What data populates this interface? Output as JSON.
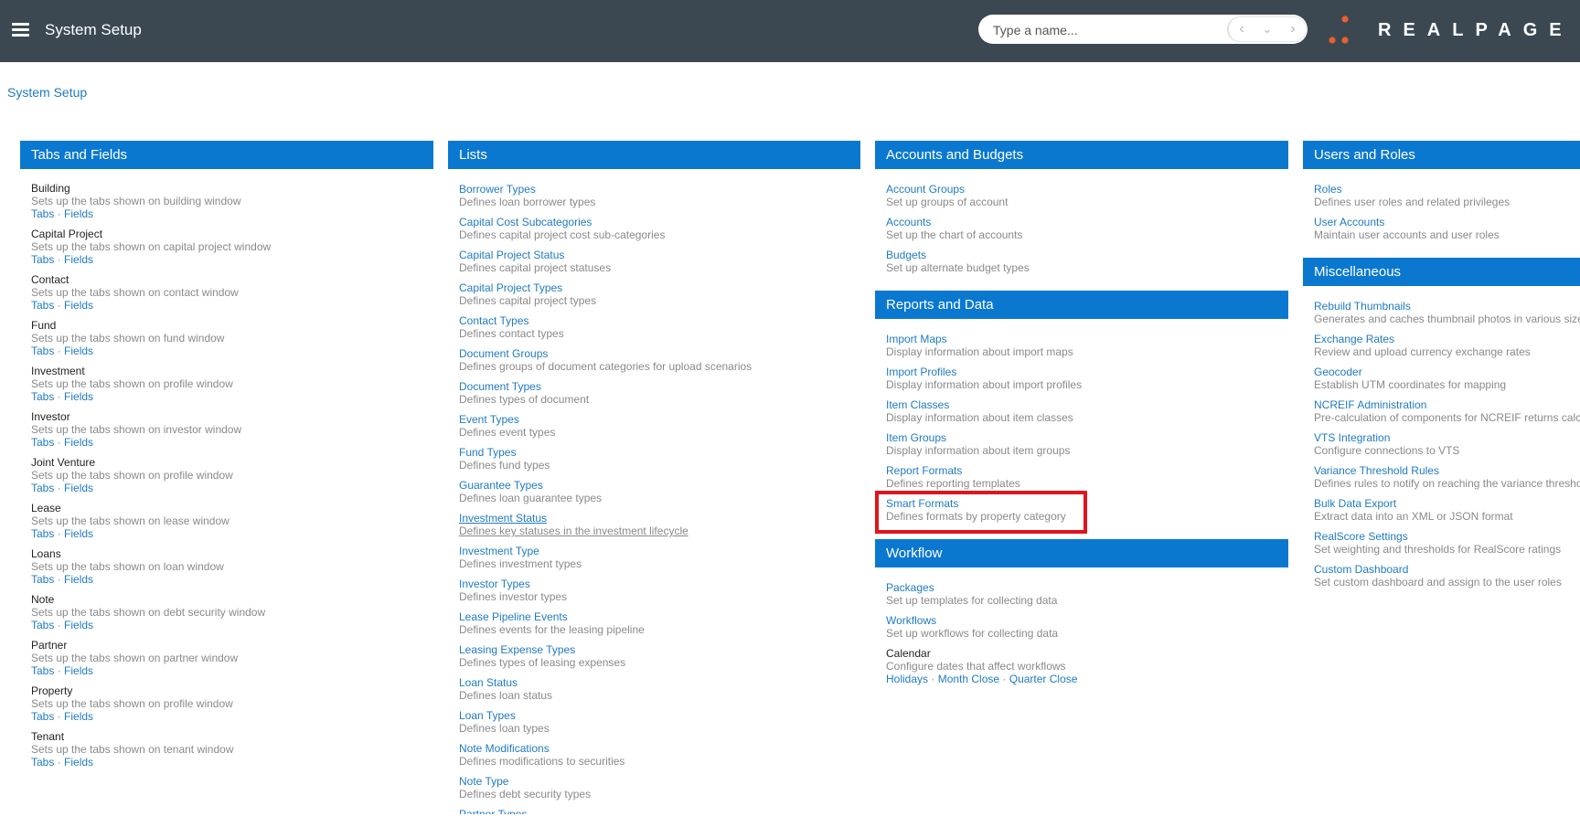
{
  "header": {
    "title": "System Setup",
    "search_placeholder": "Type a name...",
    "brand": "REALPAGE"
  },
  "breadcrumb": "System Setup",
  "tabs_and_fields": {
    "title": "Tabs and Fields",
    "tabs_label": "Tabs",
    "fields_label": "Fields",
    "items": [
      {
        "title": "Building",
        "desc": "Sets up the tabs shown on building window"
      },
      {
        "title": "Capital Project",
        "desc": "Sets up the tabs shown on capital project window"
      },
      {
        "title": "Contact",
        "desc": "Sets up the tabs shown on contact window"
      },
      {
        "title": "Fund",
        "desc": "Sets up the tabs shown on fund window"
      },
      {
        "title": "Investment",
        "desc": "Sets up the tabs shown on profile window"
      },
      {
        "title": "Investor",
        "desc": "Sets up the tabs shown on investor window"
      },
      {
        "title": "Joint Venture",
        "desc": "Sets up the tabs shown on profile window"
      },
      {
        "title": "Lease",
        "desc": "Sets up the tabs shown on lease window"
      },
      {
        "title": "Loans",
        "desc": "Sets up the tabs shown on loan window"
      },
      {
        "title": "Note",
        "desc": "Sets up the tabs shown on debt security window"
      },
      {
        "title": "Partner",
        "desc": "Sets up the tabs shown on partner window"
      },
      {
        "title": "Property",
        "desc": "Sets up the tabs shown on profile window"
      },
      {
        "title": "Tenant",
        "desc": "Sets up the tabs shown on tenant window"
      }
    ]
  },
  "lists": {
    "title": "Lists",
    "items": [
      {
        "title": "Borrower Types",
        "desc": "Defines loan borrower types"
      },
      {
        "title": "Capital Cost Subcategories",
        "desc": "Defines capital project cost sub-categories"
      },
      {
        "title": "Capital Project Status",
        "desc": "Defines capital project statuses"
      },
      {
        "title": "Capital Project Types",
        "desc": "Defines capital project types"
      },
      {
        "title": "Contact Types",
        "desc": "Defines contact types"
      },
      {
        "title": "Document Groups",
        "desc": "Defines groups of document categories for upload scenarios"
      },
      {
        "title": "Document Types",
        "desc": "Defines types of document"
      },
      {
        "title": "Event Types",
        "desc": "Defines event types"
      },
      {
        "title": "Fund Types",
        "desc": "Defines fund types"
      },
      {
        "title": "Guarantee Types",
        "desc": "Defines loan guarantee types"
      },
      {
        "title": "Investment Status",
        "desc": "Defines key statuses in the investment lifecycle"
      },
      {
        "title": "Investment Type",
        "desc": "Defines investment types"
      },
      {
        "title": "Investor Types",
        "desc": "Defines investor types"
      },
      {
        "title": "Lease Pipeline Events",
        "desc": "Defines events for the leasing pipeline"
      },
      {
        "title": "Leasing Expense Types",
        "desc": "Defines types of leasing expenses"
      },
      {
        "title": "Loan Status",
        "desc": "Defines loan status"
      },
      {
        "title": "Loan Types",
        "desc": "Defines loan types"
      },
      {
        "title": "Note Modifications",
        "desc": "Defines modifications to securities"
      },
      {
        "title": "Note Type",
        "desc": "Defines debt security types"
      },
      {
        "title": "Partner Types",
        "desc": ""
      }
    ]
  },
  "accounts_budgets": {
    "title": "Accounts and Budgets",
    "items": [
      {
        "title": "Account Groups",
        "desc": "Set up groups of account"
      },
      {
        "title": "Accounts",
        "desc": "Set up the chart of accounts"
      },
      {
        "title": "Budgets",
        "desc": "Set up alternate budget types"
      }
    ]
  },
  "reports_data": {
    "title": "Reports and Data",
    "items": [
      {
        "title": "Import Maps",
        "desc": "Display information about import maps"
      },
      {
        "title": "Import Profiles",
        "desc": "Display information about import profiles"
      },
      {
        "title": "Item Classes",
        "desc": "Display information about item classes"
      },
      {
        "title": "Item Groups",
        "desc": "Display information about item groups"
      },
      {
        "title": "Report Formats",
        "desc": "Defines reporting templates"
      },
      {
        "title": "Smart Formats",
        "desc": "Defines formats by property category"
      }
    ]
  },
  "workflow": {
    "title": "Workflow",
    "items": [
      {
        "title": "Packages",
        "desc": "Set up templates for collecting data"
      },
      {
        "title": "Workflows",
        "desc": "Set up workflows for collecting data"
      }
    ],
    "calendar": {
      "title": "Calendar",
      "desc": "Configure dates that affect workflows",
      "links": [
        "Holidays",
        "Month Close",
        "Quarter Close"
      ]
    }
  },
  "users_roles": {
    "title": "Users and Roles",
    "items": [
      {
        "title": "Roles",
        "desc": "Defines user roles and related privileges"
      },
      {
        "title": "User Accounts",
        "desc": "Maintain user accounts and user roles"
      }
    ]
  },
  "miscellaneous": {
    "title": "Miscellaneous",
    "items": [
      {
        "title": "Rebuild Thumbnails",
        "desc": "Generates and caches thumbnail photos in various sizes"
      },
      {
        "title": "Exchange Rates",
        "desc": "Review and upload currency exchange rates"
      },
      {
        "title": "Geocoder",
        "desc": "Establish UTM coordinates for mapping"
      },
      {
        "title": "NCREIF Administration",
        "desc": "Pre-calculation of components for NCREIF returns calculations"
      },
      {
        "title": "VTS Integration",
        "desc": "Configure connections to VTS"
      },
      {
        "title": "Variance Threshold Rules",
        "desc": "Defines rules to notify on reaching the variance threshold"
      },
      {
        "title": "Bulk Data Export",
        "desc": "Extract data into an XML or JSON format"
      },
      {
        "title": "RealScore Settings",
        "desc": "Set weighting and thresholds for RealScore ratings"
      },
      {
        "title": "Custom Dashboard",
        "desc": "Set custom dashboard and assign to the user roles"
      }
    ]
  },
  "colors": {
    "topbar": "#3b4852",
    "section_header": "#0b78d0",
    "link": "#1f7ac4",
    "highlight": "#e0141e",
    "brand_dots": "#e8602c"
  }
}
